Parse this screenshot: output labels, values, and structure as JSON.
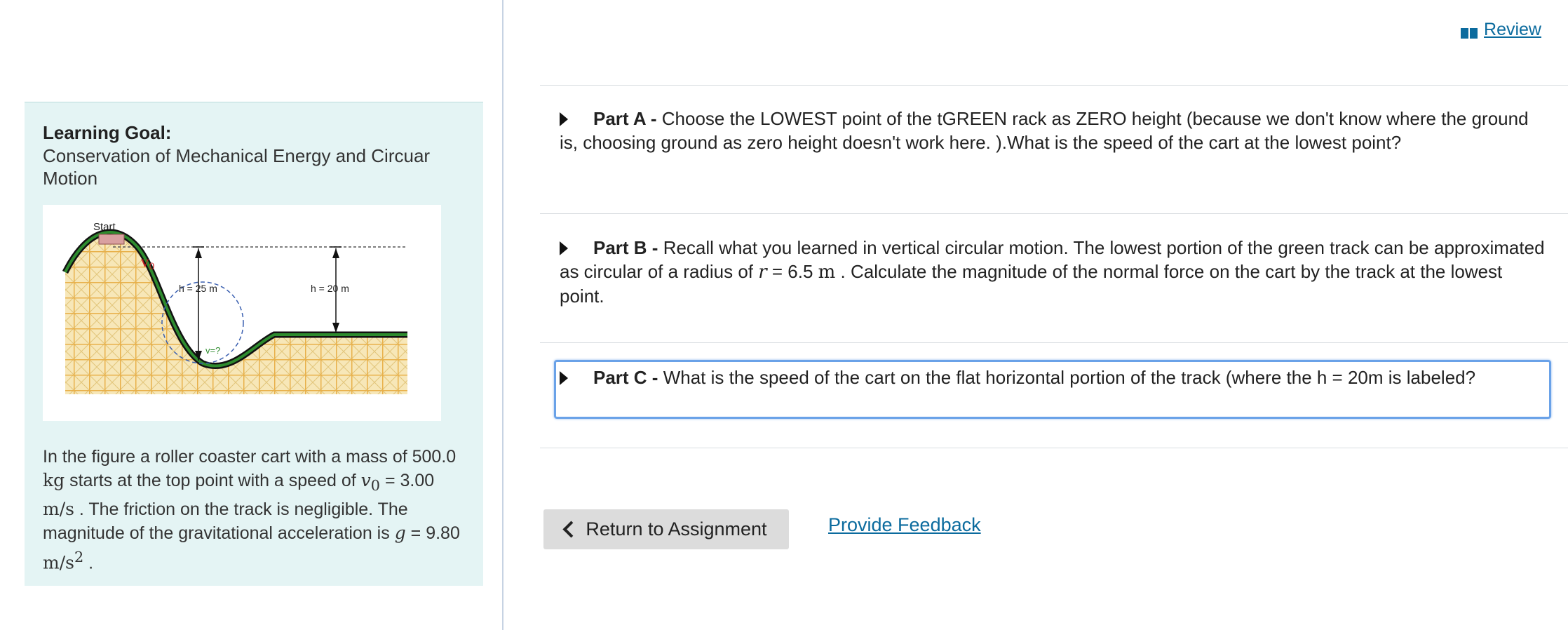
{
  "review": {
    "label": "Review",
    "icon": "book-icon"
  },
  "learning_goal": {
    "title": "Learning Goal:",
    "subtitle": "Conservation of Mechanical Energy and Circuar Motion"
  },
  "figure": {
    "start_label": "Start",
    "v0_label": "v",
    "v0_sub": "0",
    "h1_label": "h = 25 m",
    "h2_label": "h = 20 m",
    "v_label": "v=?"
  },
  "problem": {
    "t1": "In the figure a roller coaster cart with a mass of 500.0 ",
    "mass_unit": "kg",
    "t2": " starts at the top point with a speed of ",
    "v0_var": "v",
    "v0_sub": "0",
    "t3": " = 3.00 ",
    "speed_unit": "m/s",
    "t4": " . The friction on the track is negligible. The magnitude of the gravitational acceleration is ",
    "g_var": "g",
    "t5": " = 9.80 ",
    "g_unit": "m/s",
    "g_exp": "2",
    "t6": " ."
  },
  "parts": {
    "a": {
      "label": "Part A -",
      "text": " Choose the LOWEST point of the tGREEN rack as ZERO height (because we don't know where the ground is, choosing ground as zero height doesn't work here. ).What is the speed of the cart at the lowest point?"
    },
    "b": {
      "label": "Part B -",
      "t1": " Recall what you learned in vertical circular motion. The lowest portion of the green track can be approximated as circular of a radius of ",
      "r_var": "r",
      "t2": " = 6.5 ",
      "r_unit": "m",
      "t3": " .  Calculate the magnitude of the normal force on the cart by the track at the lowest point."
    },
    "c": {
      "label": "Part C -",
      "text": " What is the speed of the cart on the flat horizontal portion of the track (where the h = 20m is labeled?"
    }
  },
  "return_button": {
    "label": "Return to Assignment"
  },
  "feedback_link": {
    "label": "Provide Feedback"
  },
  "colors": {
    "panel_bg": "#e4f4f4",
    "link": "#0b6b9e",
    "focus_border": "#6aa2e8",
    "track_green": "#2e8b2e",
    "scaffold": "#e8b04a"
  }
}
